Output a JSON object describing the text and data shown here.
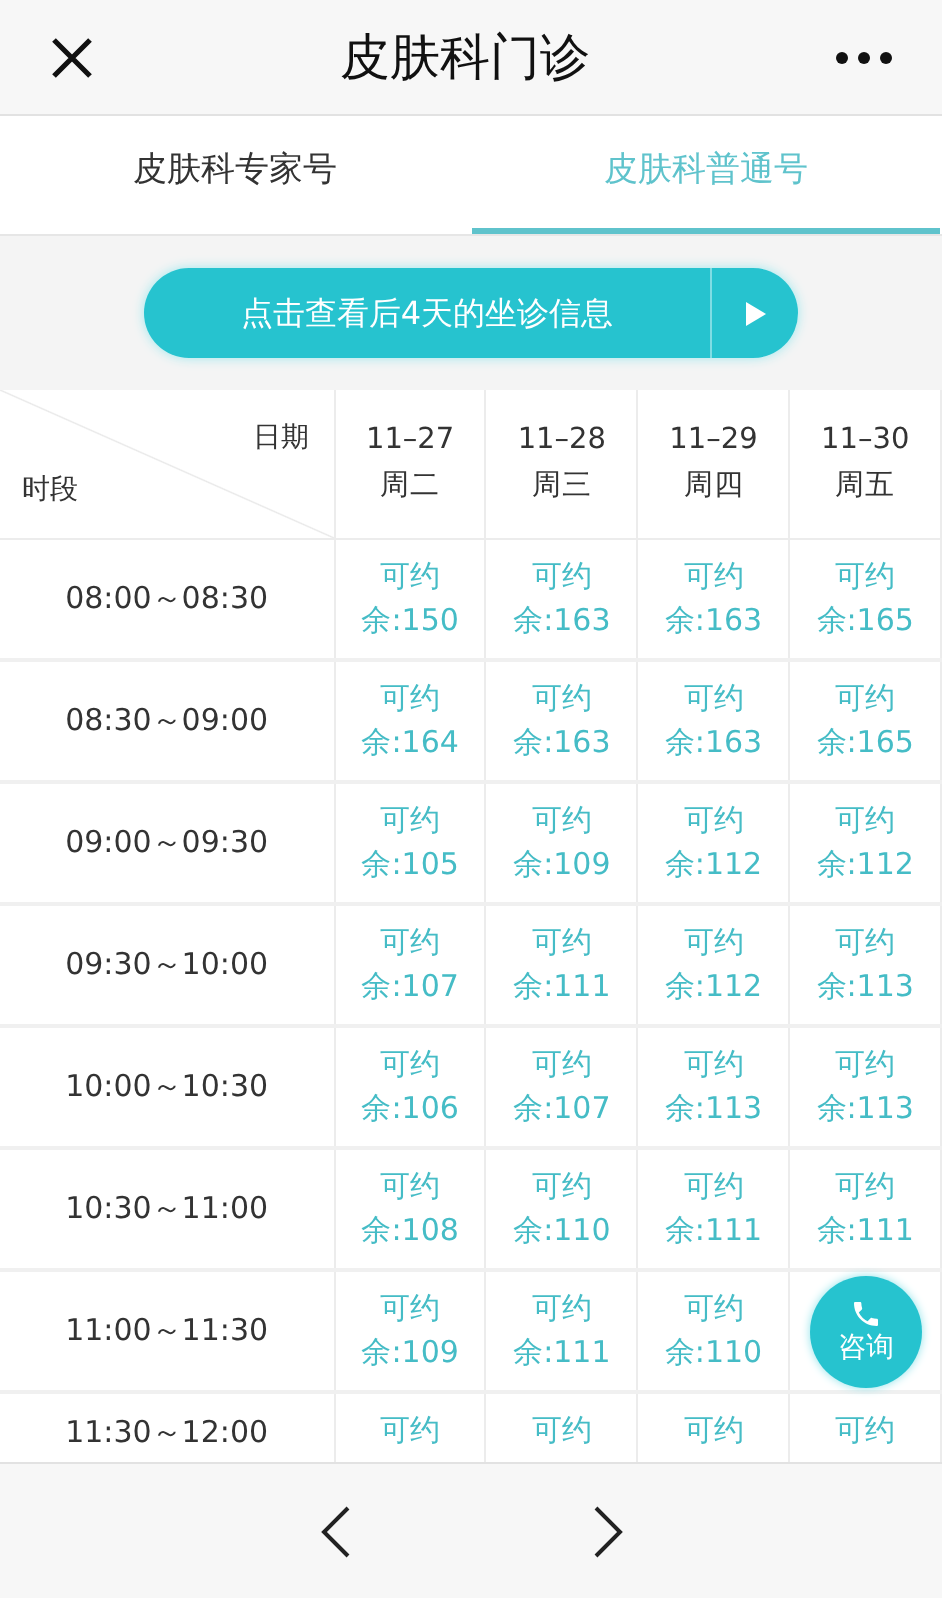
{
  "window": {
    "title": "皮肤科门诊"
  },
  "tabs": [
    {
      "label": "皮肤科专家号",
      "selected": false
    },
    {
      "label": "皮肤科普通号",
      "selected": true
    }
  ],
  "banner_button": {
    "label": "点击查看后4天的坐诊信息"
  },
  "table": {
    "corner": {
      "date_label": "日期",
      "time_label": "时段"
    },
    "columns": [
      {
        "date": "11–27",
        "weekday": "周二"
      },
      {
        "date": "11–28",
        "weekday": "周三"
      },
      {
        "date": "11–29",
        "weekday": "周四"
      },
      {
        "date": "11–30",
        "weekday": "周五"
      }
    ],
    "rows": [
      {
        "time": "08:00～08:30",
        "cells": [
          {
            "status": "可约",
            "remaining": "余:150"
          },
          {
            "status": "可约",
            "remaining": "余:163"
          },
          {
            "status": "可约",
            "remaining": "余:163"
          },
          {
            "status": "可约",
            "remaining": "余:165"
          }
        ]
      },
      {
        "time": "08:30～09:00",
        "cells": [
          {
            "status": "可约",
            "remaining": "余:164"
          },
          {
            "status": "可约",
            "remaining": "余:163"
          },
          {
            "status": "可约",
            "remaining": "余:163"
          },
          {
            "status": "可约",
            "remaining": "余:165"
          }
        ]
      },
      {
        "time": "09:00～09:30",
        "cells": [
          {
            "status": "可约",
            "remaining": "余:105"
          },
          {
            "status": "可约",
            "remaining": "余:109"
          },
          {
            "status": "可约",
            "remaining": "余:112"
          },
          {
            "status": "可约",
            "remaining": "余:112"
          }
        ]
      },
      {
        "time": "09:30～10:00",
        "cells": [
          {
            "status": "可约",
            "remaining": "余:107"
          },
          {
            "status": "可约",
            "remaining": "余:111"
          },
          {
            "status": "可约",
            "remaining": "余:112"
          },
          {
            "status": "可约",
            "remaining": "余:113"
          }
        ]
      },
      {
        "time": "10:00～10:30",
        "cells": [
          {
            "status": "可约",
            "remaining": "余:106"
          },
          {
            "status": "可约",
            "remaining": "余:107"
          },
          {
            "status": "可约",
            "remaining": "余:113"
          },
          {
            "status": "可约",
            "remaining": "余:113"
          }
        ]
      },
      {
        "time": "10:30～11:00",
        "cells": [
          {
            "status": "可约",
            "remaining": "余:108"
          },
          {
            "status": "可约",
            "remaining": "余:110"
          },
          {
            "status": "可约",
            "remaining": "余:111"
          },
          {
            "status": "可约",
            "remaining": "余:111"
          }
        ]
      },
      {
        "time": "11:00～11:30",
        "cells": [
          {
            "status": "可约",
            "remaining": "余:109"
          },
          {
            "status": "可约",
            "remaining": "余:111"
          },
          {
            "status": "可约",
            "remaining": "余:110"
          }
        ]
      },
      {
        "time": "11:30～12:00",
        "cells": [
          {
            "status": "可约"
          },
          {
            "status": "可约"
          },
          {
            "status": "可约"
          },
          {
            "status": "可约"
          }
        ]
      }
    ]
  },
  "consult_button": {
    "label": "咨询"
  }
}
